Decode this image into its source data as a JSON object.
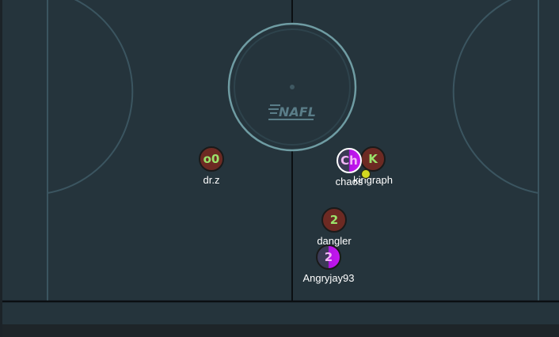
{
  "rink": {
    "logo_text": "NAFL",
    "colors": {
      "background": "#222b31",
      "ice": "#25343c",
      "lines": "#3b5560",
      "center_circle": "#6f9ca3",
      "boards": "#0b0f12",
      "team_brown": "#6d2a23",
      "team_purple": "#b513e6",
      "puck": "#d2d820"
    }
  },
  "players": [
    {
      "id": "drz",
      "name": "dr.z",
      "badge": "o0",
      "team": "brown",
      "selected": false
    },
    {
      "id": "kingraph",
      "name": "kingraph",
      "badge": "K",
      "team": "brown",
      "selected": false
    },
    {
      "id": "chaos",
      "name": "chaos",
      "badge": "Ch",
      "team": "purple",
      "selected": true
    },
    {
      "id": "dangler",
      "name": "dangler",
      "badge": "2",
      "team": "brown",
      "selected": false
    },
    {
      "id": "angryjay93",
      "name": "Angryjay93",
      "badge": "2",
      "team": "purple",
      "selected": false
    }
  ],
  "puck": {
    "icon": "puck-icon"
  }
}
